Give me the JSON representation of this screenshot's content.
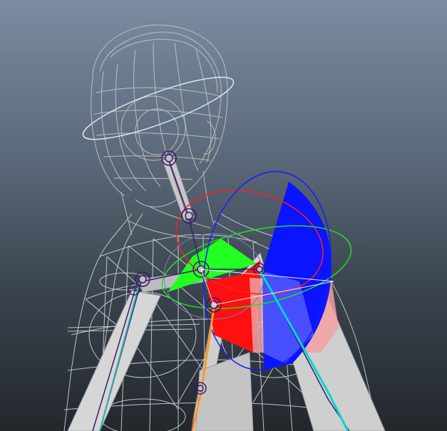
{
  "viewport": {
    "type": "3d-viewport",
    "shading": "wireframe",
    "background_gradient": [
      "#7b8ca2",
      "#23272c"
    ]
  },
  "scene": {
    "subject": "character-rig",
    "rotate_manipulator": {
      "axis_colors": {
        "x": "#ff0000",
        "y": "#00e000",
        "z": "#0000ff"
      }
    },
    "colors": {
      "wireframe": "#d8dce0",
      "wireframe_dim": "#c8c6c0",
      "joint": "#3a1a6a",
      "bone_fill": "#d6d6d6",
      "bone_stroke": "#9aa0a6",
      "highlight_bone": "#00d8d0",
      "selected_bone": "#ff9a20"
    }
  }
}
